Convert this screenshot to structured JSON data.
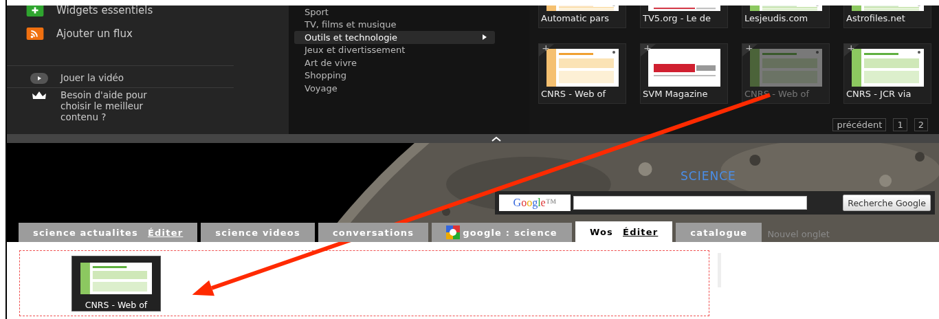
{
  "sidebar": {
    "actions": [
      {
        "kind": "add",
        "label": "Widgets essentiels"
      },
      {
        "kind": "rss",
        "label": "Ajouter un flux"
      }
    ],
    "help": [
      {
        "kind": "video",
        "label": "Jouer la vidéo"
      },
      {
        "kind": "crown",
        "label": "Besoin d'aide pour choisir le meilleur contenu ?"
      }
    ]
  },
  "categories": [
    {
      "label": "Sport",
      "selected": false
    },
    {
      "label": "TV, films et musique",
      "selected": false
    },
    {
      "label": "Outils et technologie",
      "selected": true
    },
    {
      "label": "Jeux et divertissement",
      "selected": false
    },
    {
      "label": "Art de vivre",
      "selected": false
    },
    {
      "label": "Shopping",
      "selected": false
    },
    {
      "label": "Voyage",
      "selected": false
    }
  ],
  "gallery": {
    "rows": [
      [
        {
          "title": "Automatic pars",
          "faded": false
        },
        {
          "title": "TV5.org - Le de",
          "faded": false
        },
        {
          "title": "Lesjeudis.com",
          "faded": false
        },
        {
          "title": "Astrofiles.net",
          "faded": false
        }
      ],
      [
        {
          "title": "CNRS - Web of",
          "faded": false,
          "badge": "+"
        },
        {
          "title": "SVM Magazine",
          "faded": false,
          "badge": "+"
        },
        {
          "title": "CNRS - Web of",
          "faded": true,
          "badge": "+"
        },
        {
          "title": "CNRS - JCR via",
          "faded": false,
          "badge": "+"
        }
      ]
    ],
    "pagination": {
      "previous": "précédent",
      "pages": [
        "1",
        "2"
      ]
    }
  },
  "banner": {
    "title": "SCIENCE",
    "search": {
      "logo": "Google™",
      "button": "Recherche Google"
    }
  },
  "tabs": [
    {
      "kind": "tab",
      "label": "science actualites",
      "edit": "Éditer",
      "selected": false
    },
    {
      "kind": "tab",
      "label": "science videos",
      "selected": false
    },
    {
      "kind": "tab",
      "label": "conversations",
      "selected": false
    },
    {
      "kind": "google",
      "label": "google : science",
      "selected": false
    },
    {
      "kind": "tab",
      "label": "Wos",
      "edit": "Éditer",
      "selected": true
    },
    {
      "kind": "tab",
      "label": "catalogue",
      "selected": false
    },
    {
      "kind": "new",
      "label": "Nouvel onglet",
      "selected": false
    }
  ],
  "dropzone": {
    "cards": [
      {
        "title": "CNRS - Web of"
      }
    ]
  }
}
